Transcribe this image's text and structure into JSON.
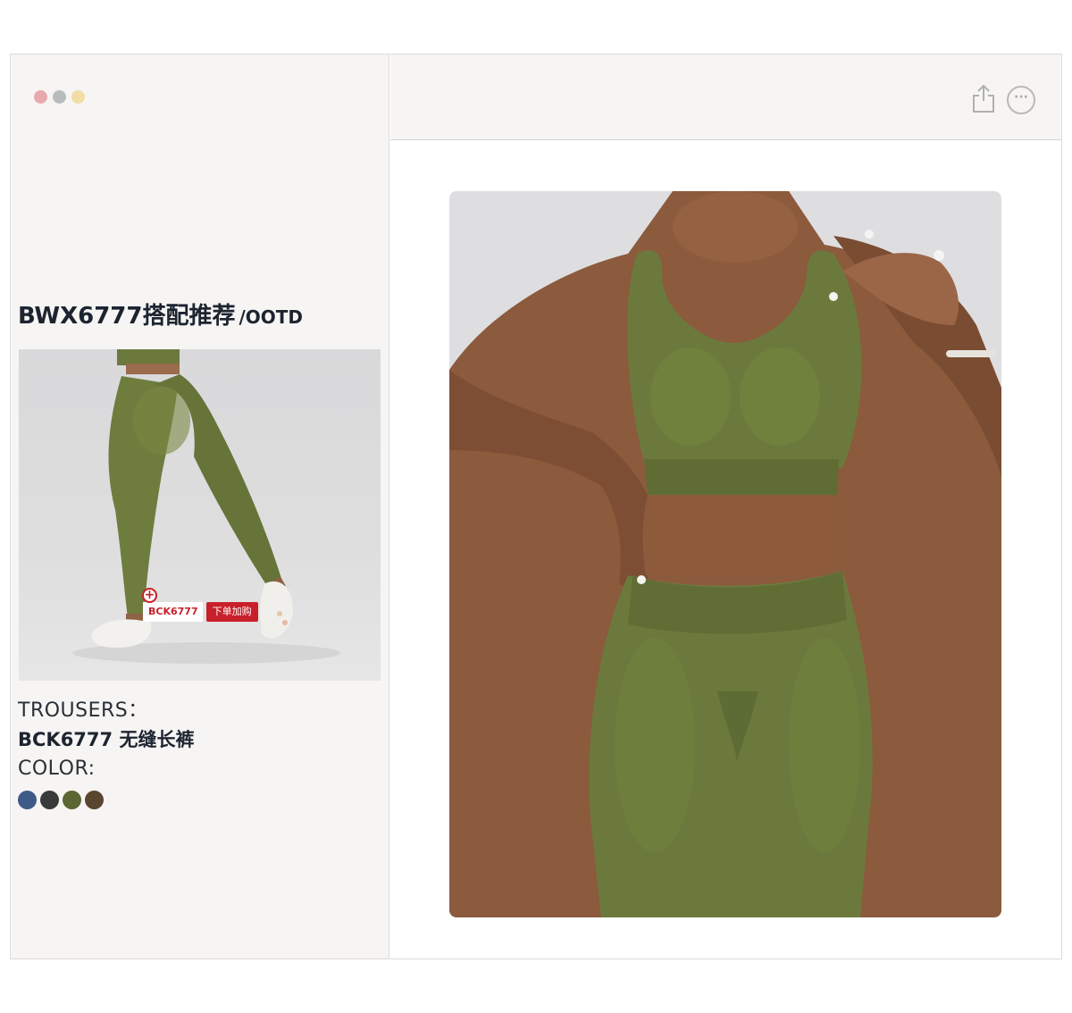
{
  "window": {
    "traffic_lights": [
      "#e8a9ae",
      "#b9bcbc",
      "#f3dca6"
    ]
  },
  "sidebar": {
    "title_main": "BWX6777搭配推荐",
    "title_sub": "/OOTD",
    "product_tag": {
      "code": "BCK6777",
      "cta": "下单加购"
    },
    "trousers_label": "TROUSERS：",
    "trousers_name": "BCK6777 无缝长裤",
    "color_label": "COLOR:",
    "colors": [
      "#3e5a86",
      "#3a3a3a",
      "#5b6632",
      "#5a4530"
    ]
  },
  "header": {
    "share_icon": "share-icon",
    "more_icon": "more-icon",
    "more_glyph": "···"
  },
  "main": {
    "hero_image": "product-photo-olive-sports-bra-leggings",
    "accent": "#6b7a3c"
  }
}
